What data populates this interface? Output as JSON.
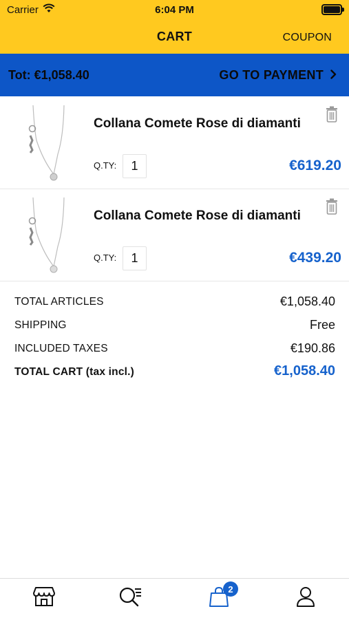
{
  "status_bar": {
    "carrier": "Carrier",
    "time": "6:04 PM"
  },
  "nav": {
    "title": "CART",
    "coupon_label": "COUPON"
  },
  "payment_bar": {
    "total_text": "Tot: €1,058.40",
    "go_label": "GO TO PAYMENT"
  },
  "items": [
    {
      "name": "Collana Comete Rose di diamanti",
      "qty_label": "Q.TY:",
      "qty": "1",
      "price": "€619.20"
    },
    {
      "name": "Collana Comete Rose di diamanti",
      "qty_label": "Q.TY:",
      "qty": "1",
      "price": "€439.20"
    }
  ],
  "summary": {
    "total_articles_label": "TOTAL ARTICLES",
    "total_articles_value": "€1,058.40",
    "shipping_label": "SHIPPING",
    "shipping_value": "Free",
    "taxes_label": "INCLUDED TAXES",
    "taxes_value": "€190.86",
    "total_cart_label": "TOTAL CART (tax incl.)",
    "total_cart_value": "€1,058.40"
  },
  "tab_bar": {
    "tabs": [
      {
        "icon": "store-icon"
      },
      {
        "icon": "search-list-icon"
      },
      {
        "icon": "bag-icon",
        "badge": "2",
        "active": true
      },
      {
        "icon": "user-icon"
      }
    ]
  },
  "colors": {
    "yellow": "#FFC91F",
    "blue": "#0D56C7",
    "price_blue": "#1662CC"
  }
}
